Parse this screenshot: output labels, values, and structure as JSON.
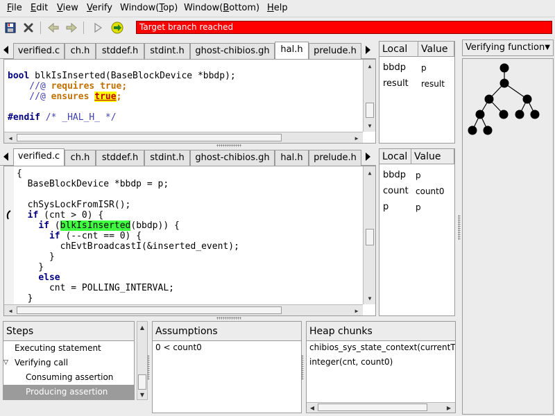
{
  "menu": {
    "items": [
      {
        "pre": "",
        "u": "F",
        "post": "ile"
      },
      {
        "pre": "",
        "u": "E",
        "post": "dit"
      },
      {
        "pre": "",
        "u": "V",
        "post": "iew"
      },
      {
        "pre": "",
        "u": "V",
        "post": "erify"
      },
      {
        "pre": "Window(",
        "u": "T",
        "post": "op)"
      },
      {
        "pre": "Window(",
        "u": "B",
        "post": "ottom)"
      },
      {
        "pre": "",
        "u": "H",
        "post": "elp"
      }
    ]
  },
  "status": {
    "message": "Target branch reached",
    "color": "#ff0000"
  },
  "tabs": [
    "verified.c",
    "ch.h",
    "stddef.h",
    "stdint.h",
    "ghost-chibios.gh",
    "hal.h",
    "prelude.h"
  ],
  "top_editor": {
    "active_tab": "hal.h"
  },
  "bottom_editor": {
    "active_tab": "verified.c"
  },
  "code_top": {
    "l1_kw": "bool",
    "l1_text": " blkIsInserted(BaseBlockDevice *bbdp);",
    "l2_cmt": "    //@ ",
    "l2_spec": "requires",
    "l2_sp": " ",
    "l2_true": "true",
    "l2_semi": ";",
    "l3_cmt": "    //@ ",
    "l3_spec": "ensures",
    "l3_sp": " ",
    "l3_true": "true",
    "l3_semi": ";",
    "l4_kw": "#endif",
    "l4_cmt": " /* _HAL_H_ */"
  },
  "code_bottom": {
    "l1": "{",
    "l2": "  BaseBlockDevice *bbdp = p;",
    "l3": "  chSysLockFromISR();",
    "l4_ind": "  ",
    "l4_kw": "if",
    "l4_rest": " (cnt > 0) {",
    "l5_ind": "    ",
    "l5_kw": "if",
    "l5_pre": " (",
    "l5_hl": "blkIsInserted",
    "l5_post": "(bbdp)) {",
    "l6_ind": "      ",
    "l6_kw": "if",
    "l6_rest": " (--cnt == 0) {",
    "l7": "        chEvtBroadcastI(&inserted_event);",
    "l8": "      }",
    "l9": "    }",
    "l10_ind": "    ",
    "l10_kw": "else",
    "l11": "      cnt = POLLING_INTERVAL;",
    "l12": "  }"
  },
  "locals_top": {
    "headers": [
      "Local",
      "Value"
    ],
    "rows": [
      [
        "bbdp",
        "p"
      ],
      [
        "result",
        "result"
      ]
    ]
  },
  "locals_bottom": {
    "headers": [
      "Local",
      "Value"
    ],
    "rows": [
      [
        "bbdp",
        "p"
      ],
      [
        "count",
        "count0"
      ],
      [
        "p",
        "p"
      ]
    ]
  },
  "steps": {
    "header": "Steps",
    "items": [
      "Executing statement",
      "Verifying call",
      "Consuming assertion",
      "Producing assertion"
    ]
  },
  "assumptions": {
    "header": "Assumptions",
    "items": [
      "0 < count0"
    ]
  },
  "heap": {
    "header": "Heap chunks",
    "items": [
      "chibios_sys_state_context(currentThr",
      "integer(cnt, count0)"
    ]
  },
  "right_pane": {
    "dropdown": "Verifying function"
  }
}
